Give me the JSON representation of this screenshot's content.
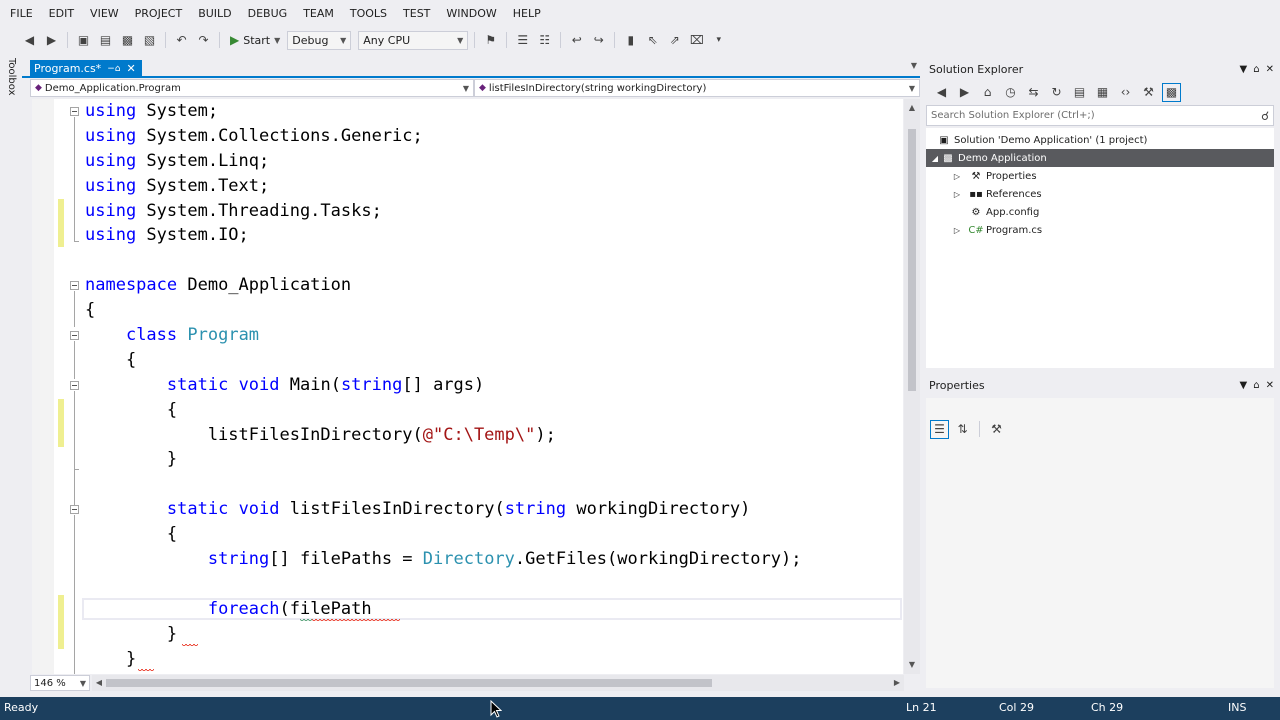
{
  "menu": [
    "FILE",
    "EDIT",
    "VIEW",
    "PROJECT",
    "BUILD",
    "DEBUG",
    "TEAM",
    "TOOLS",
    "TEST",
    "WINDOW",
    "HELP"
  ],
  "toolbar": {
    "start_label": "Start",
    "config_value": "Debug",
    "platform_value": "Any CPU"
  },
  "toolbox_label": "Toolbox",
  "editor": {
    "tab_label": "Program.cs*",
    "nav_left": "Demo_Application.Program",
    "nav_right": "listFilesInDirectory(string workingDirectory)",
    "zoom": "146 %",
    "lines": [
      "using System;",
      "using System.Collections.Generic;",
      "using System.Linq;",
      "using System.Text;",
      "using System.Threading.Tasks;",
      "using System.IO;",
      "",
      "namespace Demo_Application",
      "{",
      "    class Program",
      "    {",
      "        static void Main(string[] args)",
      "        {",
      "            listFilesInDirectory(@\"C:\\Temp\\\");",
      "        }",
      "",
      "        static void listFilesInDirectory(string workingDirectory)",
      "        {",
      "            string[] filePaths = Directory.GetFiles(workingDirectory);",
      "",
      "            foreach(filePath",
      "        }",
      "    }"
    ]
  },
  "solution_explorer": {
    "title": "Solution Explorer",
    "search_placeholder": "Search Solution Explorer (Ctrl+;)",
    "solution_label": "Solution 'Demo Application' (1 project)",
    "project_label": "Demo Application",
    "items": [
      "Properties",
      "References",
      "App.config",
      "Program.cs"
    ]
  },
  "properties": {
    "title": "Properties"
  },
  "status": {
    "ready": "Ready",
    "line": "Ln 21",
    "col": "Col 29",
    "ch": "Ch 29",
    "mode": "INS"
  },
  "colors": {
    "keyword": "#0000ff",
    "type": "#2b91af",
    "string": "#a31515",
    "accent": "#007acc",
    "statusbar": "#1c3f5e"
  }
}
